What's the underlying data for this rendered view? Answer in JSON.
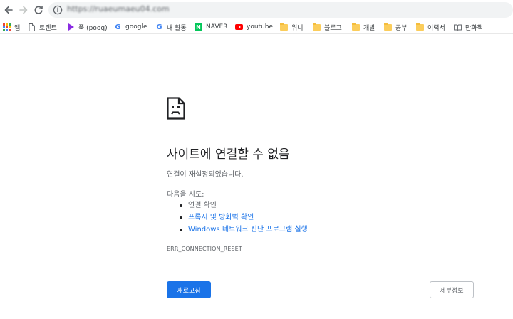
{
  "toolbar": {
    "url": "https://ruaeumaeu04.com"
  },
  "bookmarks": [
    {
      "label": "앱"
    },
    {
      "label": "토렌트"
    },
    {
      "label": "푹 (pooq)"
    },
    {
      "label": "google"
    },
    {
      "label": "내 활동"
    },
    {
      "label": "NAVER"
    },
    {
      "label": "youtube"
    },
    {
      "label": "위니"
    },
    {
      "label": "블로그"
    },
    {
      "label": "개발"
    },
    {
      "label": "공부"
    },
    {
      "label": "이력서"
    },
    {
      "label": "만화책"
    }
  ],
  "error": {
    "title": "사이트에 연결할 수 없음",
    "description": "연결이 재설정되었습니다.",
    "try_label": "다음을 시도:",
    "suggestions": [
      {
        "label": "연결 확인"
      },
      {
        "label": "프록시 및 방화벽 확인"
      },
      {
        "label": "Windows 네트워크 진단 프로그램 실행"
      }
    ],
    "code": "ERR_CONNECTION_RESET",
    "reload_label": "새로고침",
    "details_label": "세부정보"
  },
  "colors": {
    "accent": "#1a73e8",
    "text": "#202124",
    "secondary_text": "#5f6368",
    "omnibox_bg": "#f1f3f4"
  }
}
